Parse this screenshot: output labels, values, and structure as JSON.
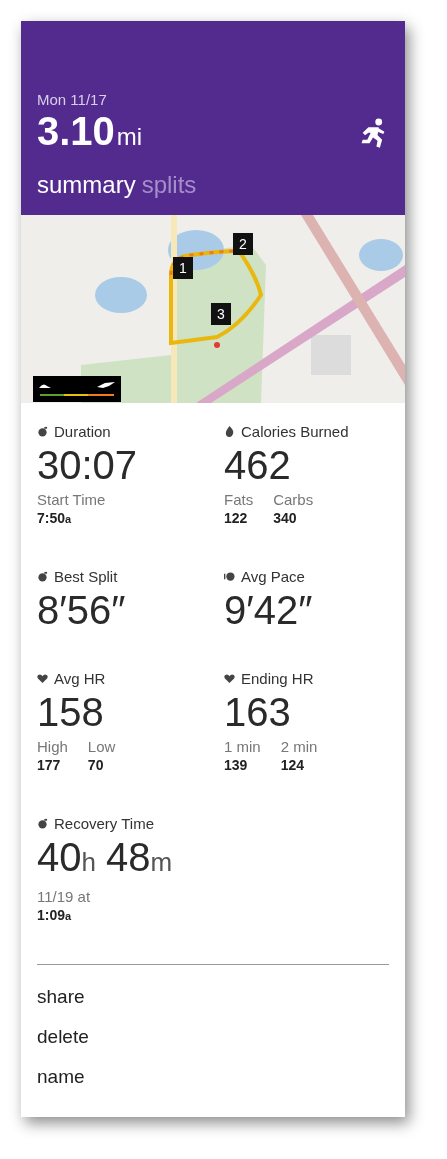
{
  "header": {
    "date": "Mon 11/17",
    "distance": "3.10",
    "unit": "mi",
    "tabs": [
      {
        "label": "summary",
        "selected": true
      },
      {
        "label": "splits",
        "selected": false
      }
    ]
  },
  "map": {
    "markers": [
      {
        "label": "1"
      },
      {
        "label": "2"
      },
      {
        "label": "3"
      }
    ]
  },
  "stats": [
    {
      "kind": "stopwatch",
      "label": "Duration",
      "value": [
        {
          "num": "30:07"
        }
      ],
      "details": [
        {
          "label": "Start Time",
          "value": "7:50",
          "unit": "a"
        }
      ]
    },
    {
      "kind": "flame",
      "label": "Calories Burned",
      "value": [
        {
          "num": "462"
        }
      ],
      "details": [
        {
          "label": "Fats",
          "value": "122"
        },
        {
          "label": "Carbs",
          "value": "340"
        }
      ]
    },
    {
      "kind": "stopwatch",
      "label": "Best Split",
      "value": [
        {
          "num": "8′56″"
        }
      ]
    },
    {
      "kind": "gauge",
      "label": "Avg Pace",
      "value": [
        {
          "num": "9′42″"
        }
      ]
    },
    {
      "kind": "heart",
      "label": "Avg HR",
      "value": [
        {
          "num": "158"
        }
      ],
      "details": [
        {
          "label": "High",
          "value": "177"
        },
        {
          "label": "Low",
          "value": "70"
        }
      ]
    },
    {
      "kind": "heart",
      "label": "Ending HR",
      "value": [
        {
          "num": "163"
        }
      ],
      "details": [
        {
          "label": "1 min",
          "value": "139"
        },
        {
          "label": "2 min",
          "value": "124"
        }
      ]
    },
    {
      "kind": "stopwatch",
      "label": "Recovery Time",
      "value": [
        {
          "num": "40",
          "unit": "h"
        },
        {
          "num": "48",
          "unit": "m"
        }
      ],
      "details": [
        {
          "label": "11/19 at",
          "value": "1:09",
          "unit": "a"
        }
      ]
    }
  ],
  "actions": [
    "share",
    "delete",
    "name"
  ]
}
